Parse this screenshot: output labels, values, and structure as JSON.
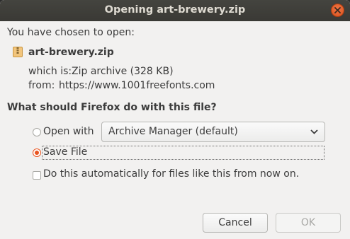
{
  "titlebar": {
    "title": "Opening art-brewery.zip",
    "close_icon": "close-icon"
  },
  "intro": {
    "text": "You have chosen to open:"
  },
  "file": {
    "name": "art-brewery.zip",
    "icon": "archive-file-icon",
    "which_is_label": "which is:",
    "which_is_value": "Zip archive (328 KB)",
    "from_label": "from:",
    "from_value": "https://www.1001freefonts.com"
  },
  "question": "What should Firefox do with this file?",
  "options": {
    "open_with_label": "Open with",
    "open_with_selected": false,
    "open_with_app": "Archive Manager (default)",
    "save_file_label": "Save File",
    "save_file_selected": true,
    "auto_label": "Do this automatically for files like this from now on.",
    "auto_checked": false
  },
  "buttons": {
    "cancel_label": "Cancel",
    "ok_label": "OK",
    "ok_enabled": false
  },
  "colors": {
    "accent": "#e95420",
    "titlebar": "#3c3b37"
  }
}
